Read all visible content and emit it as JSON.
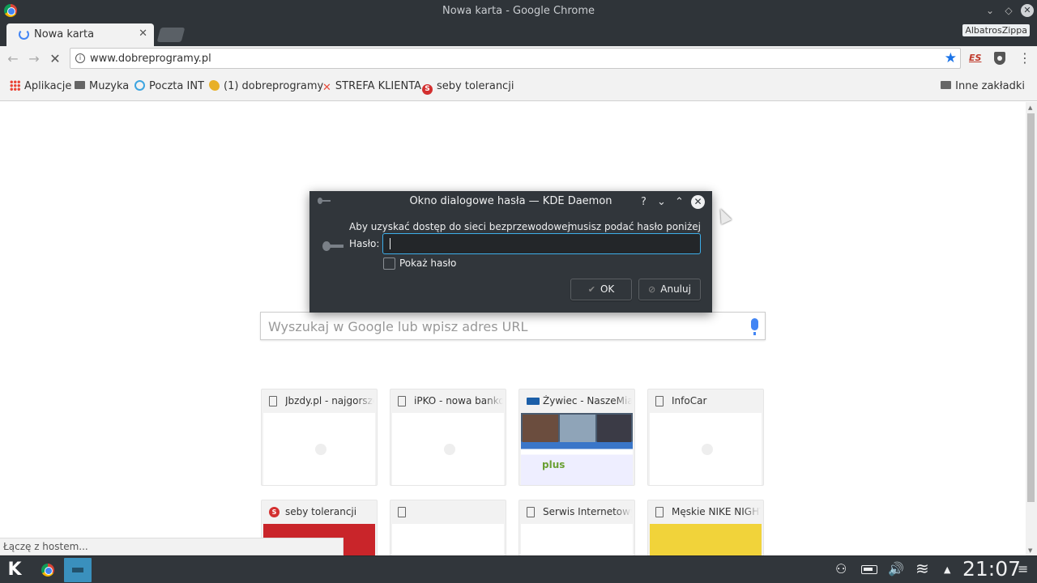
{
  "window": {
    "title": "Nowa karta - Google Chrome",
    "min_glyph": "⌄",
    "max_glyph": "◇",
    "close_glyph": "✕"
  },
  "tabs": [
    {
      "label": "Nowa karta",
      "close_glyph": "✕"
    }
  ],
  "profile_name": "AlbatrosZippa",
  "toolbar": {
    "back_glyph": "←",
    "forward_glyph": "→",
    "stop_glyph": "✕",
    "info_glyph": "i",
    "url": "www.dobreprogramy.pl",
    "star_glyph": "★",
    "ext_es_label": "ES",
    "menu_glyph": "⋮"
  },
  "bookmarks": {
    "items": [
      {
        "label": "Aplikacje",
        "icon": "apps-grid-icon"
      },
      {
        "label": "Muzyka",
        "icon": "folder-icon"
      },
      {
        "label": "Poczta INT",
        "icon": "poczta-icon"
      },
      {
        "label": "(1) dobreprogramy",
        "icon": "dobreprogramy-icon"
      },
      {
        "label": "STREFA KLIENTA",
        "icon": "strefa-icon"
      },
      {
        "label": "seby tolerancji",
        "icon": "seby-icon"
      }
    ],
    "other_label": "Inne zakładki",
    "strefa_glyph": "✕",
    "seby_glyph": "S"
  },
  "search": {
    "placeholder": "Wyszukaj w Google lub wpisz adres URL"
  },
  "most_visited": [
    {
      "title": "Jbzdy.pl - najgorsze of"
    },
    {
      "title": "iPKO - nowa bankowo"
    },
    {
      "title": "Żywiec - NaszeMiasto"
    },
    {
      "title": "InfoCar"
    },
    {
      "title": "seby tolerancji"
    },
    {
      "title": ""
    },
    {
      "title": "Serwis Internetowy IP"
    },
    {
      "title": "Męskie NIKE NIGHTG"
    }
  ],
  "tile_labels": {
    "plus_logo": "plus"
  },
  "dialog": {
    "title": "Okno dialogowe hasła — KDE Daemon",
    "help_glyph": "?",
    "min_glyph": "⌄",
    "max_glyph": "⌃",
    "close_glyph": "✕",
    "message_left": "Aby uzyskać dostęp do sieci bezprzewodowej",
    "message_right": "musisz podać hasło poniżej",
    "password_label": "Hasło:",
    "password_value": "",
    "show_password_label": "Pokaż hasło",
    "show_password_checked": false,
    "ok_label": "OK",
    "ok_glyph": "✔",
    "cancel_label": "Anuluj",
    "cancel_glyph": "⊘"
  },
  "status_text": "Łączę z hostem...",
  "taskbar": {
    "launcher_glyph": "K",
    "clock": "21:07",
    "user_glyph": "⚇",
    "volume_glyph": "🔊",
    "wifi_glyph": "≋",
    "tray_expand_glyph": "▲",
    "tray_menu_glyph": "≡"
  },
  "colors": {
    "accent": "#3daee9",
    "dialog_bg": "#31363b",
    "titlebar_bg": "#2f3439",
    "google_blue": "#4285f4"
  }
}
